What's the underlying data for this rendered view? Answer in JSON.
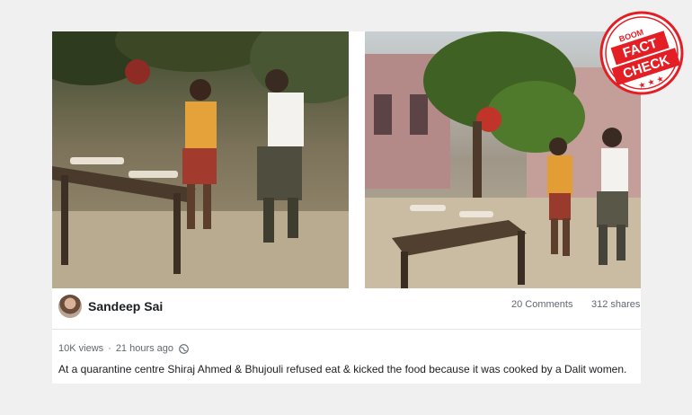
{
  "post": {
    "author": "Sandeep Sai",
    "comments": "20 Comments",
    "shares": "312 shares",
    "views": "10K views",
    "separator": "·",
    "time": "21 hours ago",
    "caption": "At a quarantine centre Shiraj Ahmed & Bhujouli refused eat & kicked the food because it was cooked by a Dalit women."
  },
  "badge": {
    "brand": "BOOM",
    "line1": "FACT",
    "line2": "CHECK",
    "color": "#e31e24"
  },
  "icons": {
    "avatar": "avatar-photo",
    "globe": "globe-icon",
    "left_video": "video-frame-left",
    "right_video": "video-frame-right"
  }
}
